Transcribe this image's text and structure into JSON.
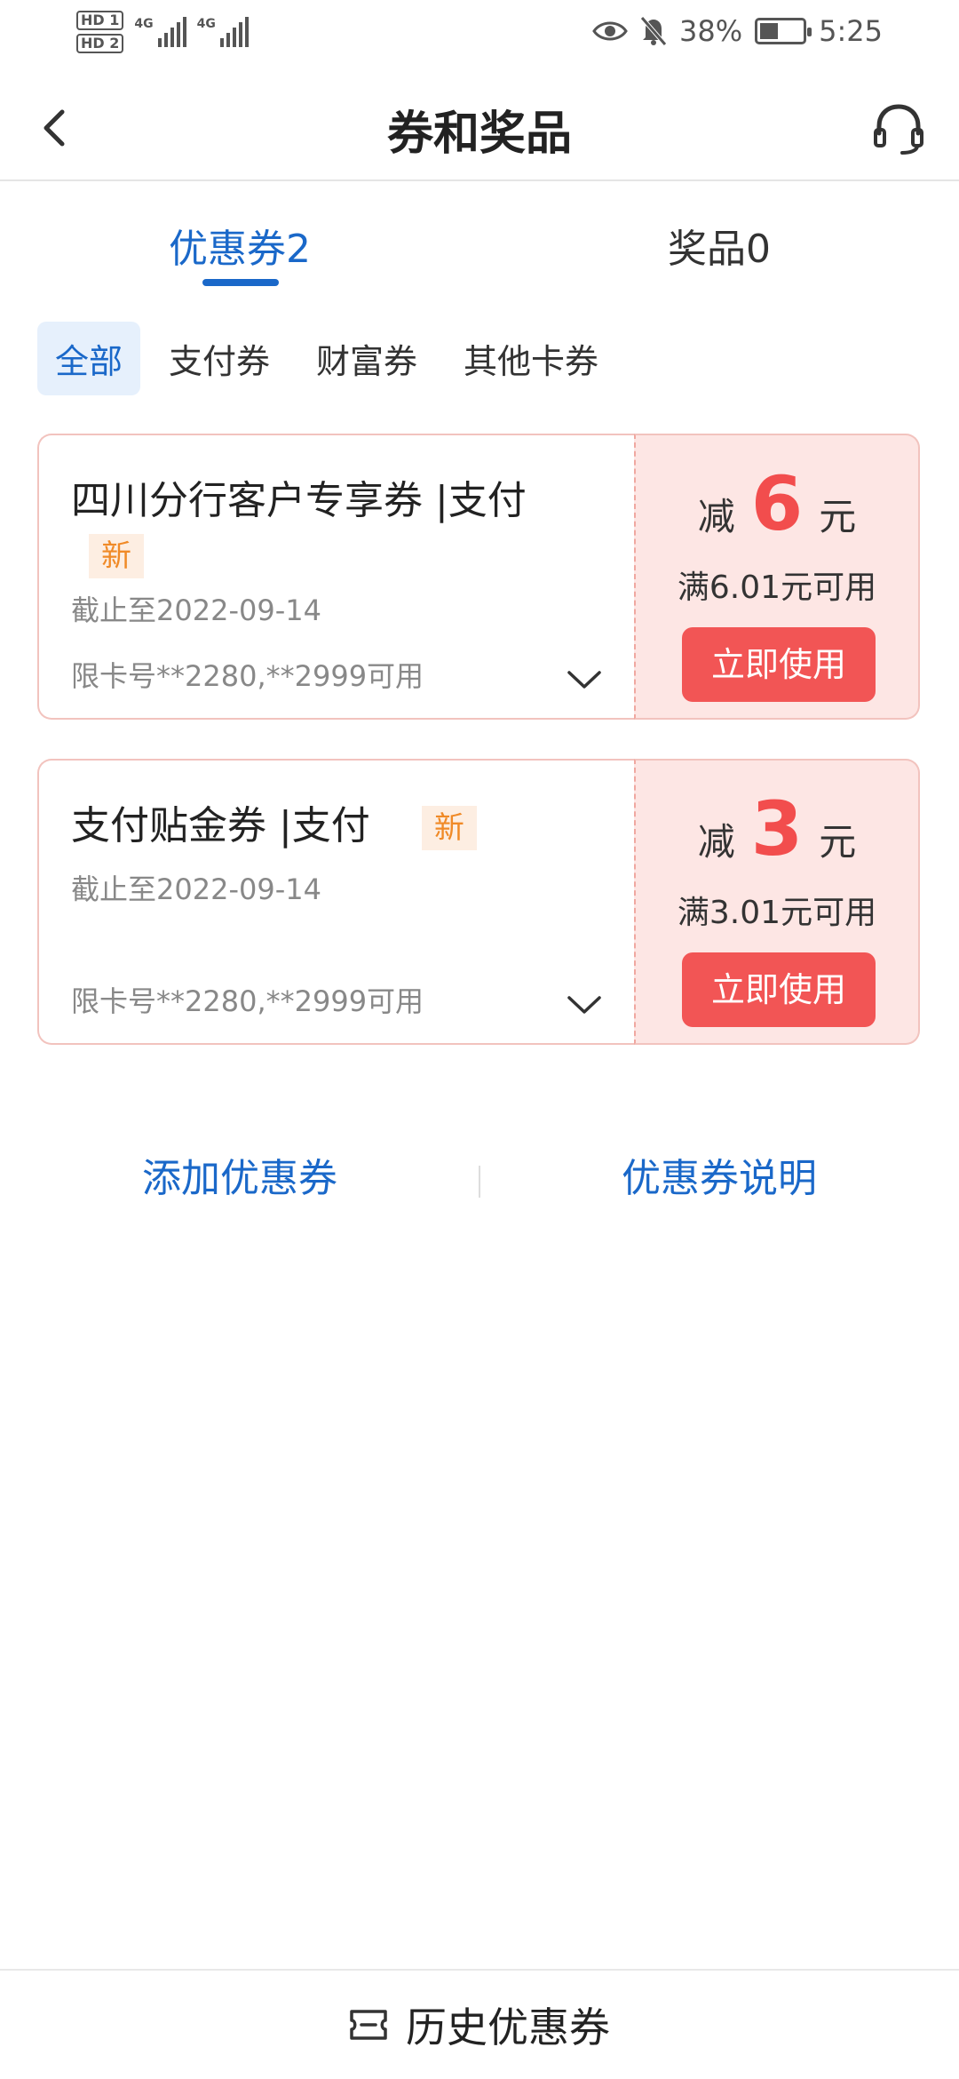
{
  "status": {
    "hd1": "HD 1",
    "hd2": "HD 2",
    "net1": "4G",
    "net2": "4G",
    "battery": "38%",
    "time": "5:25"
  },
  "header": {
    "title": "券和奖品"
  },
  "tabs": [
    {
      "label": "优惠券2"
    },
    {
      "label": "奖品0"
    }
  ],
  "filters": [
    {
      "label": "全部"
    },
    {
      "label": "支付券"
    },
    {
      "label": "财富券"
    },
    {
      "label": "其他卡券"
    }
  ],
  "coupons": [
    {
      "title": "四川分行客户专享券 |支付",
      "badge": "新",
      "date": "截止至2022-09-14",
      "limit": "限卡号**2280,**2999可用",
      "reduce_label": "减",
      "amount": "6",
      "unit": "元",
      "condition": "满6.01元可用",
      "button": "立即使用"
    },
    {
      "title": "支付贴金券 |支付",
      "badge": "新",
      "date": "截止至2022-09-14",
      "limit": "限卡号**2280,**2999可用",
      "reduce_label": "减",
      "amount": "3",
      "unit": "元",
      "condition": "满3.01元可用",
      "button": "立即使用"
    }
  ],
  "links": {
    "add": "添加优惠券",
    "explain": "优惠券说明"
  },
  "footer": {
    "history": "历史优惠券"
  },
  "colors": {
    "brand_blue": "#1a68c9",
    "coupon_red": "#f25555",
    "badge_orange": "#f08a27"
  }
}
